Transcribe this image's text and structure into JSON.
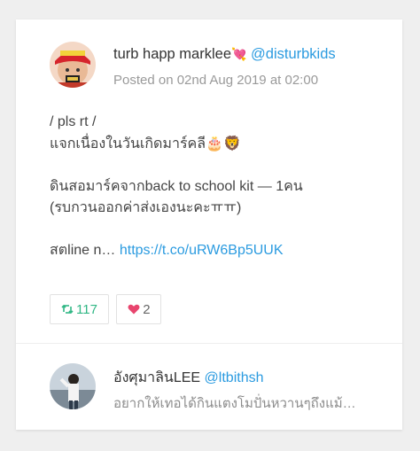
{
  "tweet": {
    "author_name": "turb happ marklee",
    "author_heart": "💘",
    "author_handle": "@disturbkids",
    "posted": "Posted on 02nd Aug 2019 at 02:00",
    "line1": "/ pls rt /",
    "line2": "แจกเนื่องในวันเกิดมาร์คลี",
    "line2_emoji": "🎂🦁",
    "line3": "ดินสอมาร์คจากback to school kit — 1คน",
    "line4": "(รบกวนออกค่าส่งเองนะคะㅠㅠ)",
    "line5_prefix": "สตline n…",
    "link": "https://t.co/uRW6Bp5UUK",
    "retweets": "117",
    "likes": "2"
  },
  "reply": {
    "author_name": "อังศุมาลินLEE",
    "author_handle": "@ltbithsh",
    "preview": "อยากให้เทอได้กินแตงโมปั่นหวานๆถึงแม้…"
  },
  "colors": {
    "link": "#2b9be0",
    "retweet": "#31b785",
    "like": "#e8456e"
  },
  "icons": {
    "retweet": "retweet-icon",
    "like": "heart-icon"
  }
}
